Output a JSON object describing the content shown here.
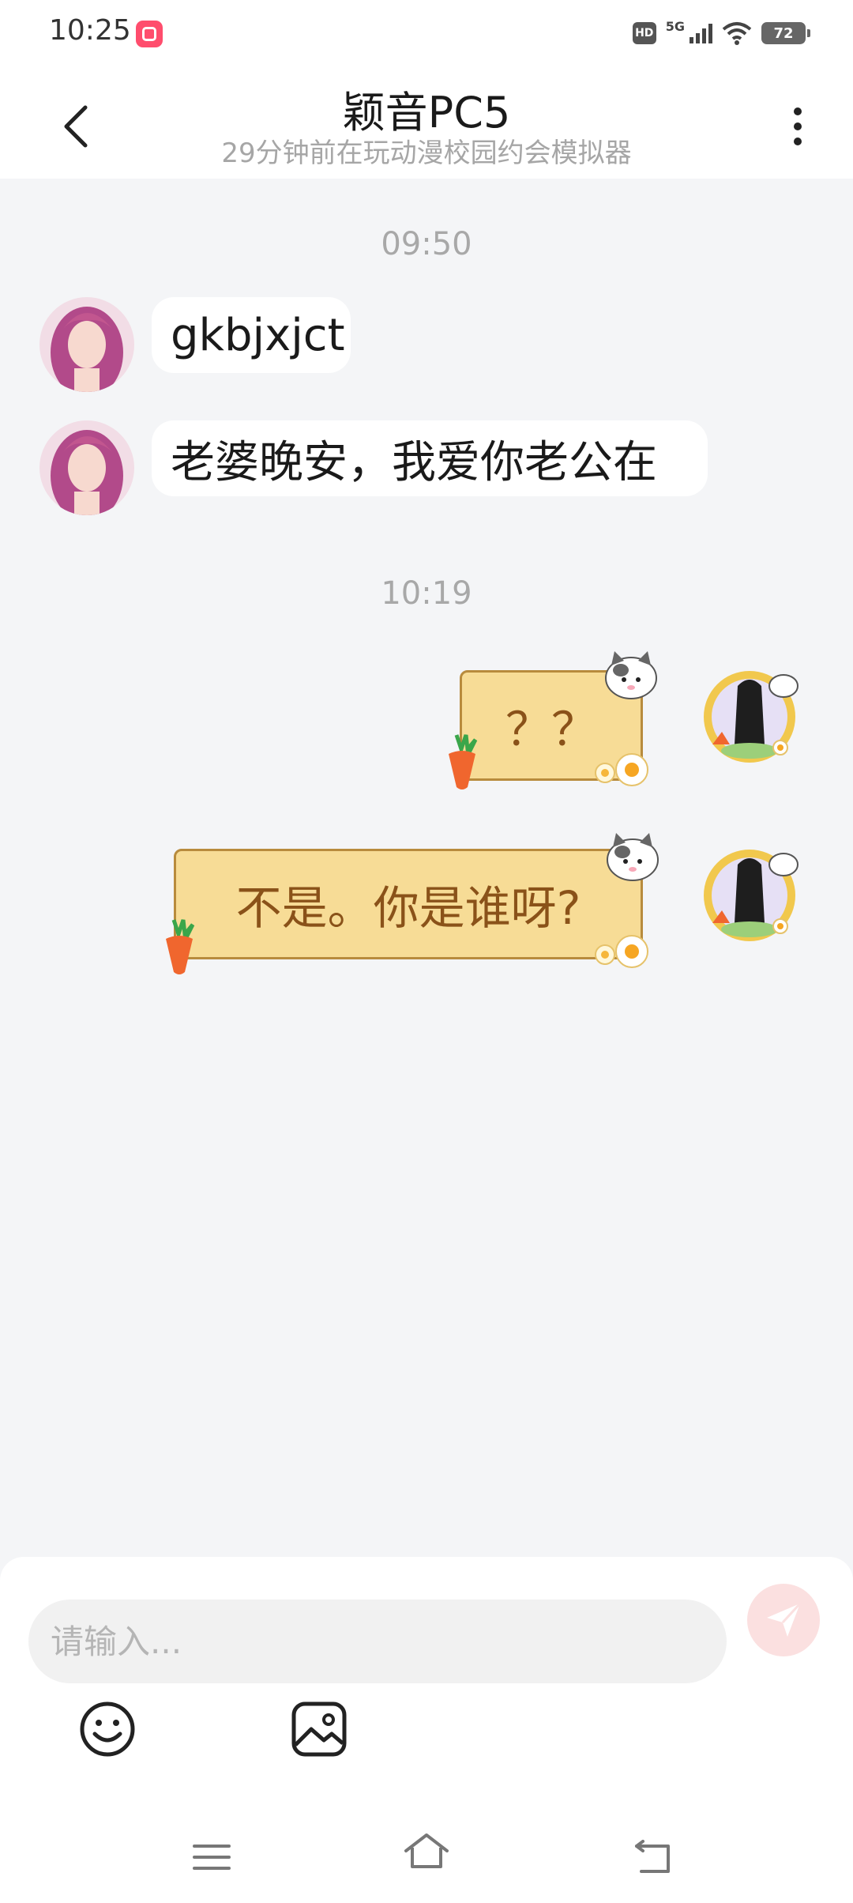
{
  "status_bar": {
    "time": "10:25",
    "hd": "HD",
    "network": "5G",
    "battery": "72"
  },
  "header": {
    "title": "颖音PC5",
    "subtitle": "29分钟前在玩动漫校园约会模拟器",
    "back_icon": "chevron-left-icon",
    "more_icon": "more-vertical-icon"
  },
  "messages": [
    {
      "type": "timestamp",
      "text": "09:50"
    },
    {
      "type": "incoming",
      "text": "gkbjxjct"
    },
    {
      "type": "incoming",
      "text": "老婆晚安，我爱你老公在"
    },
    {
      "type": "timestamp",
      "text": "10:19"
    },
    {
      "type": "outgoing",
      "text": "？？"
    },
    {
      "type": "outgoing",
      "text": "不是。你是谁呀?"
    }
  ],
  "composer": {
    "placeholder": "请输入...",
    "send_icon": "paper-plane-icon",
    "emoji_icon": "smiley-icon",
    "image_icon": "image-icon"
  },
  "colors": {
    "background": "#f4f5f7",
    "bubble_incoming": "#ffffff",
    "bubble_outgoing": "#f7dc96",
    "bubble_outgoing_text": "#8a5219",
    "send_button": "#fbe0e0"
  }
}
